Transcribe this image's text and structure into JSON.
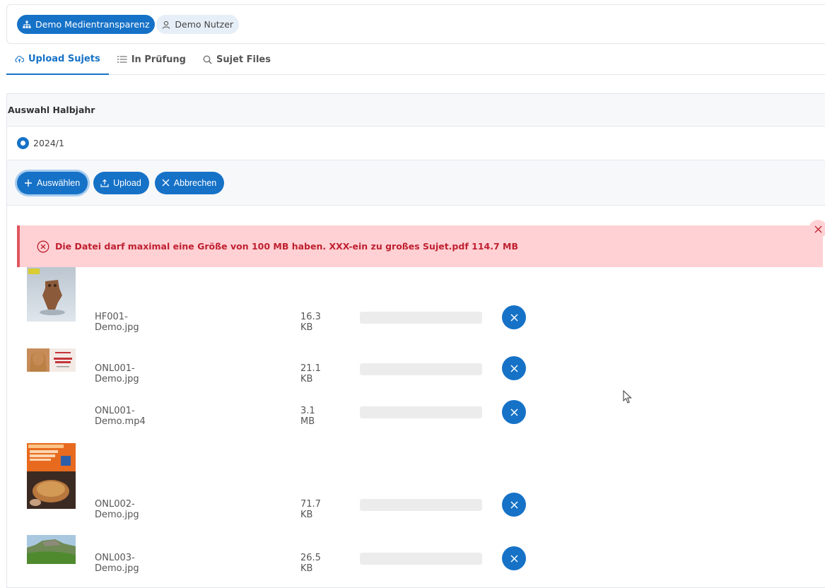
{
  "header": {
    "chip_org": "Demo Medientransparenz",
    "chip_user": "Demo Nutzer"
  },
  "tabs": [
    {
      "label": "Upload Sujets",
      "active": true
    },
    {
      "label": "In Prüfung",
      "active": false
    },
    {
      "label": "Sujet Files",
      "active": false
    }
  ],
  "section": {
    "title": "Auswahl Halbjahr",
    "period_option": "2024/1"
  },
  "toolbar": {
    "select_label": "Auswählen",
    "upload_label": "Upload",
    "cancel_label": "Abbrechen"
  },
  "error": {
    "message": "Die Datei darf maximal eine Größe von 100 MB haben.  XXX-ein zu großes Sujet.pdf 114.7 MB"
  },
  "files": [
    {
      "name": "HF001-Demo.jpg",
      "size": "16.3 KB",
      "progress": 0
    },
    {
      "name": "ONL001-Demo.jpg",
      "size": "21.1 KB",
      "progress": 0
    },
    {
      "name": "ONL001-Demo.mp4",
      "size": "3.1 MB",
      "progress": 0
    },
    {
      "name": "ONL002-Demo.jpg",
      "size": "71.7 KB",
      "progress": 0
    },
    {
      "name": "ONL003-Demo.jpg",
      "size": "26.5 KB",
      "progress": 0
    }
  ],
  "colors": {
    "primary": "#1672c7",
    "error_bg": "#ffd1d4",
    "error_text": "#bf2030"
  }
}
